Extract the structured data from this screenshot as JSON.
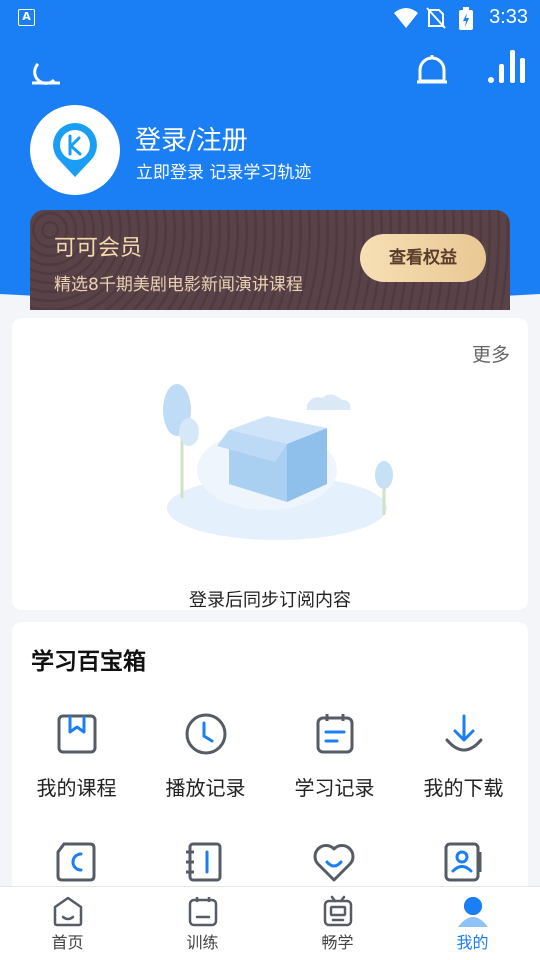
{
  "status_bar": {
    "time": "3:33",
    "app_badge": "A"
  },
  "header": {
    "login_title": "登录/注册",
    "login_subtitle": "立即登录 记录学习轨迹"
  },
  "vip": {
    "title": "可可会员",
    "subtitle": "精选8千期美剧电影新闻演讲课程",
    "button_label": "查看权益"
  },
  "subscriptions": {
    "more_label": "更多",
    "empty_text": "登录后同步订阅内容"
  },
  "toolbox": {
    "title": "学习百宝箱",
    "items": [
      {
        "label": "我的课程",
        "icon": "bookmark-book-icon"
      },
      {
        "label": "播放记录",
        "icon": "clock-icon"
      },
      {
        "label": "学习记录",
        "icon": "notes-icon"
      },
      {
        "label": "我的下载",
        "icon": "download-icon"
      }
    ]
  },
  "tabbar": {
    "tabs": [
      {
        "label": "首页",
        "icon": "home-icon"
      },
      {
        "label": "训练",
        "icon": "training-icon"
      },
      {
        "label": "畅学",
        "icon": "learn-tv-icon"
      },
      {
        "label": "我的",
        "icon": "profile-icon",
        "active": true
      }
    ]
  },
  "colors": {
    "primary": "#1a7ef5",
    "vip_gold": "#f3d9ae",
    "vip_bg": "#51393f"
  }
}
